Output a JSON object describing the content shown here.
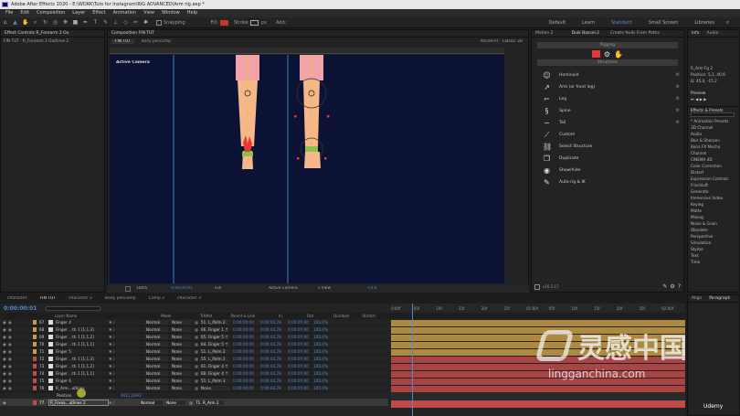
{
  "title_bar": {
    "text": "Adobe After Effects 2020 - E:\\WORK\\Tuts for Instagram\\RIG ADVANCED\\Arm rig.aep *"
  },
  "menu": [
    "File",
    "Edit",
    "Composition",
    "Layer",
    "Effect",
    "Animation",
    "View",
    "Window",
    "Help"
  ],
  "toolbar": {
    "snapping": "Snapping",
    "fill": "Fill:",
    "stroke": "Stroke",
    "stroke_px": "px",
    "add": "Add:",
    "workspaces": [
      "Default",
      "Learn",
      "Standard",
      "Small Screen",
      "Libraries"
    ],
    "active_workspace": "Standard"
  },
  "left_panel": {
    "tab": "Effect Controls R_Forearm 2 Ou",
    "line": "FIN TUT · R_Forearm 2 Outlines 2"
  },
  "composition": {
    "tab": "Composition FIN TUT",
    "subtabs": [
      "FIN TUT",
      "Body pencomp"
    ],
    "renderer": "Renderer:",
    "renderer_value": "Classic 3D",
    "camera_label": "Active Camera",
    "zoom": "100%",
    "timecode": "0:00:00:01",
    "resolution": "Full",
    "view": "Active Camera",
    "views": "1 View",
    "exposure": "+0.0"
  },
  "duik": {
    "tabs": [
      "Motion 2",
      "Duik Bassel.2",
      "Create Nulls From Paths"
    ],
    "section1": "Rigging",
    "section2": "Structures",
    "items": [
      "Hominoid",
      "Arm (or front leg)",
      "Leg",
      "Spine",
      "Tail",
      "Custom",
      "Select Structure",
      "Duplicate",
      "Show/hide",
      "Auto-rig & IK"
    ],
    "version": "v16.2.17"
  },
  "right_column": {
    "info_tab": "Info",
    "audio_tab": "Audio",
    "info_lines": [
      "R_Arm Fg 2",
      "Position: 5,1, 40,9",
      "Ω: 45,0, -15,2"
    ],
    "preview": "Preview",
    "effects_tab": "Effects & Presets",
    "effects": [
      "* Animation Presets",
      "3D Channel",
      "Audio",
      "Blur & Sharpen",
      "Boris FX Mocha",
      "Channel",
      "CINEMA 4D",
      "Color Correction",
      "Distort",
      "Expression Controls",
      "Frischluft",
      "Generate",
      "Immersive Video",
      "Keying",
      "Matte",
      "Mixing",
      "Noise & Grain",
      "Obsolete",
      "Perspective",
      "Simulation",
      "Stylize",
      "Text",
      "Time"
    ],
    "align": "Align",
    "paragraph": "Paragraph"
  },
  "timeline": {
    "tabs": [
      "character",
      "FIN TUT",
      "character 2",
      "Body pencomp",
      "Comp 2",
      "character 3"
    ],
    "active_tab": "FIN TUT",
    "timecode": "0:00:00:01",
    "columns": [
      "Layer Name",
      "Mode",
      "TrkMat",
      "Parent & Link",
      "In",
      "Out",
      "Duration",
      "Stretch"
    ],
    "layers": [
      {
        "num": "67",
        "name": "Finger 4",
        "mode": "Normal",
        "parent": "51. L_Palm 2",
        "color": "#c79c47"
      },
      {
        "num": "68",
        "name": "Finger ...th 1 [1,1,3]",
        "mode": "Normal",
        "parent": "66. Finger 1 ↑",
        "color": "#c79c47"
      },
      {
        "num": "69",
        "name": "Finger ...th 1 [1,1,2]",
        "mode": "Normal",
        "parent": "65. Finger 5 ↑",
        "color": "#c79c47"
      },
      {
        "num": "70",
        "name": "Finger ...th 1 [1,1,1]",
        "mode": "Normal",
        "parent": "64. Finger 5 ↑",
        "color": "#c79c47"
      },
      {
        "num": "71",
        "name": "Finger 5",
        "mode": "Normal",
        "parent": "51. L_Palm 2",
        "color": "#c79c47"
      },
      {
        "num": "72",
        "name": "Finger ...th 1 [1,1,3]",
        "mode": "Normal",
        "parent": "55. L_Palm 2",
        "color": "#c04a4a"
      },
      {
        "num": "73",
        "name": "Finger ...th 1 [1,1,2]",
        "mode": "Normal",
        "parent": "61. Finger 4 ↑",
        "color": "#c04a4a"
      },
      {
        "num": "74",
        "name": "Finger ...th 1 [1,1,1]",
        "mode": "Normal",
        "parent": "60. Finger 4 ↑",
        "color": "#c04a4a"
      },
      {
        "num": "75",
        "name": "Finger 6",
        "mode": "Normal",
        "parent": "51. L_Palm 3",
        "color": "#c04a4a"
      },
      {
        "num": "76",
        "name": "R_Arm...utlines",
        "mode": "Normal",
        "parent": "None",
        "color": "#c04a4a"
      }
    ],
    "sub_property": "Position",
    "sub_value": "4012,2093",
    "selected_layer": {
      "num": "77",
      "name": "R_Forea...utlines 2",
      "mode": "Normal",
      "parent": "71. R_Arm 2"
    },
    "in_value": "0:00:00:00",
    "out_value": "0:00:04:29",
    "duration_value": "0:00:05:00",
    "stretch": "100,0%",
    "ruler_marks": [
      "0:00f",
      "05f",
      "10f",
      "15f",
      "20f",
      "25f",
      "01:00f",
      "05f",
      "10f",
      "15f",
      "20f",
      "25f",
      "02:00f"
    ]
  },
  "watermark": {
    "text": "灵感中国",
    "url": "lingganchina.com",
    "udemy": "Udemy"
  }
}
